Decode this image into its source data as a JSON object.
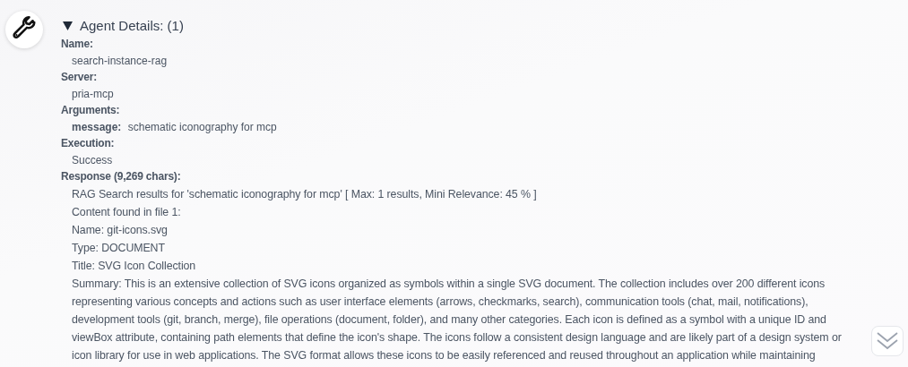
{
  "details": {
    "title": "Agent Details: (1)",
    "expanded": true,
    "fields": [
      {
        "label": "Name:",
        "kind": "text",
        "value": "search-instance-rag"
      },
      {
        "label": "Server:",
        "kind": "text",
        "value": "pria-mcp"
      },
      {
        "label": "Arguments:",
        "kind": "args",
        "args": [
          {
            "key": "message:",
            "value": "schematic iconography for mcp"
          }
        ]
      },
      {
        "label": "Execution:",
        "kind": "text",
        "value": "Success"
      },
      {
        "label": "Response (9,269 chars):",
        "kind": "lines",
        "lines": [
          "RAG Search results for 'schematic iconography for mcp' [ Max: 1 results, Mini Relevance: 45 % ]",
          "Content found in file 1:",
          "Name: git-icons.svg",
          "Type: DOCUMENT",
          "Title: SVG Icon Collection",
          "Summary: This is an extensive collection of SVG icons organized as symbols within a single SVG document. The collection includes over 200 different icons representing various concepts and actions such as user interface elements (arrows, checkmarks, search), communication tools (chat, mail, notifications), development tools (git, branch, merge), file operations (document, folder), and many other categories. Each icon is defined as a symbol with a unique ID and viewBox attribute, containing path elements that define the icon's shape. The icons follow a consistent design language and are likely part of a design system or icon library for use in web applications. The SVG format allows these icons to be easily referenced and reused throughout an application while maintaining"
        ]
      }
    ]
  }
}
